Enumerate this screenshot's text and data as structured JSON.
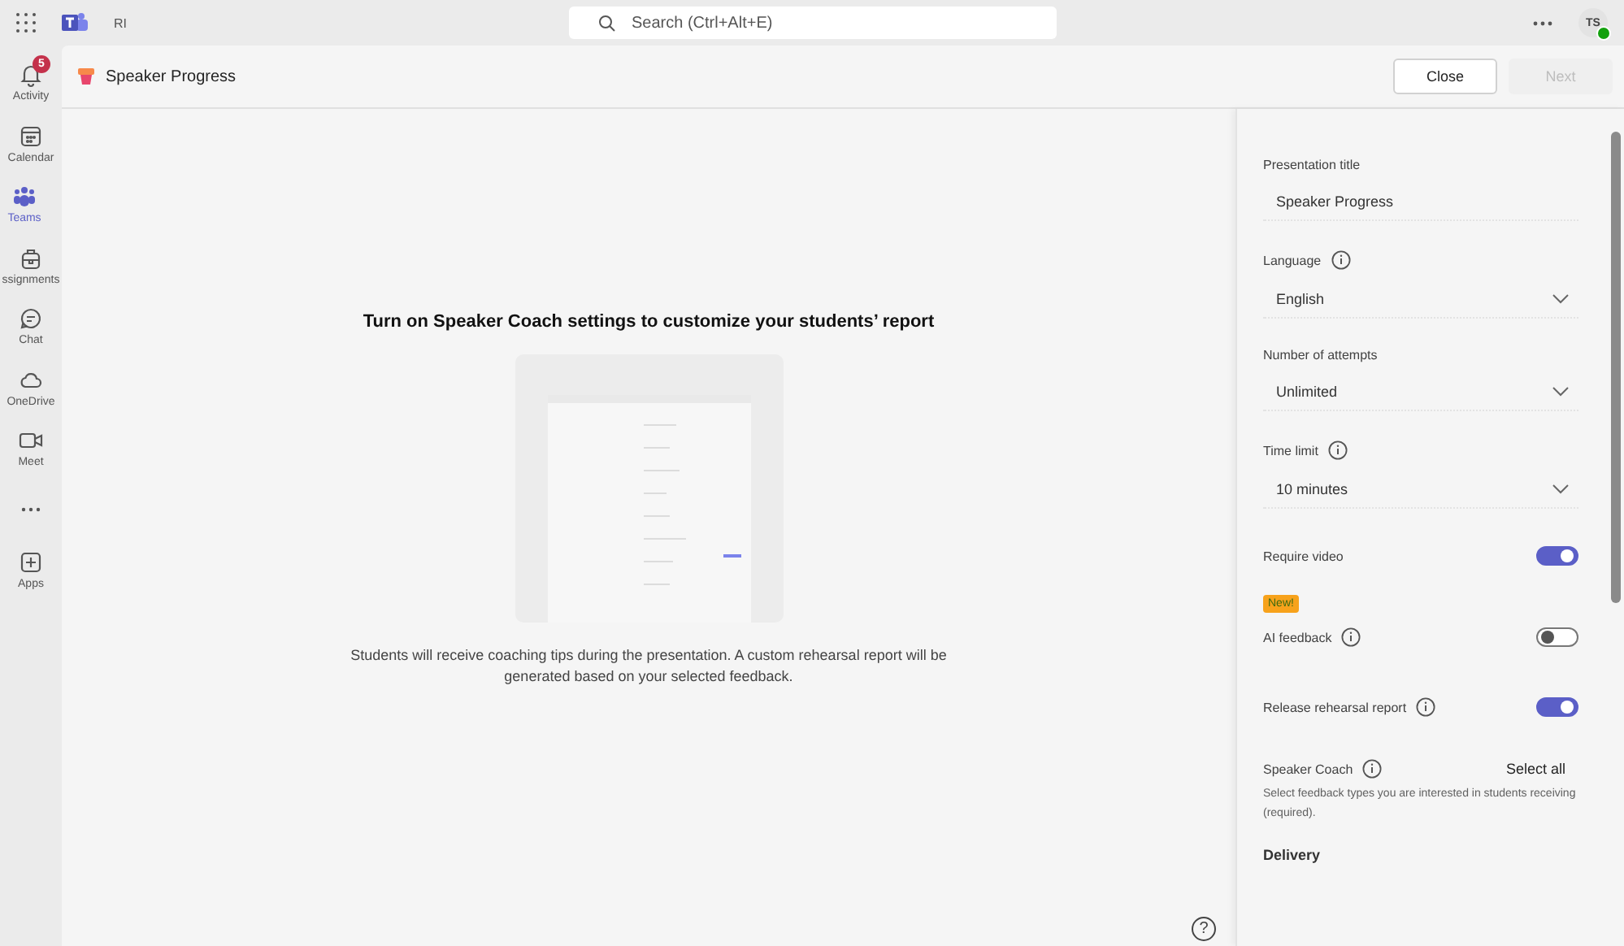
{
  "top_bar": {
    "org_label": "RI",
    "search": {
      "placeholder": "Search (Ctrl+Alt+E)"
    },
    "avatar_initials": "TS"
  },
  "nav": [
    {
      "label": "Activity",
      "badge": "5",
      "selected": false
    },
    {
      "label": "Calendar",
      "selected": false
    },
    {
      "label": "Teams",
      "selected": true
    },
    {
      "label": "ssignments",
      "selected": false
    },
    {
      "label": "Chat",
      "selected": false
    },
    {
      "label": "OneDrive",
      "selected": false
    },
    {
      "label": "Meet",
      "selected": false
    },
    {
      "selected": false
    },
    {
      "label": "Apps",
      "selected": false
    }
  ],
  "header": {
    "title": "Speaker Progress",
    "buttons": [
      {
        "label": "Close",
        "disabled": false
      },
      {
        "label": "Next",
        "disabled": true
      }
    ]
  },
  "main": {
    "heading": "Turn on Speaker Coach settings to customize your students’ report",
    "description": "Students will receive coaching tips during the presentation. A custom rehearsal report will be generated based on your selected feedback.",
    "help_label": "?"
  },
  "panel": {
    "fields": [
      {
        "kind": "text",
        "label": "Presentation title",
        "value": "Speaker Progress",
        "info": false
      },
      {
        "kind": "select",
        "label": "Language",
        "value": "English",
        "info": true
      },
      {
        "kind": "select",
        "label": "Number of attempts",
        "value": "Unlimited",
        "info": false
      },
      {
        "kind": "select",
        "label": "Time limit",
        "value": "10 minutes",
        "info": true
      },
      {
        "kind": "toggle",
        "label": "Require video",
        "on": true,
        "info": false
      },
      {
        "kind": "toggle",
        "label": "AI feedback",
        "on": false,
        "info": true,
        "badge": "New!"
      },
      {
        "kind": "toggle",
        "label": "Release rehearsal report",
        "on": true,
        "info": true
      }
    ],
    "speaker_coach": {
      "label": "Speaker Coach",
      "action": "Select all",
      "description": "Select feedback types you are interested in students receiving (required)."
    },
    "section_heading": "Delivery"
  }
}
